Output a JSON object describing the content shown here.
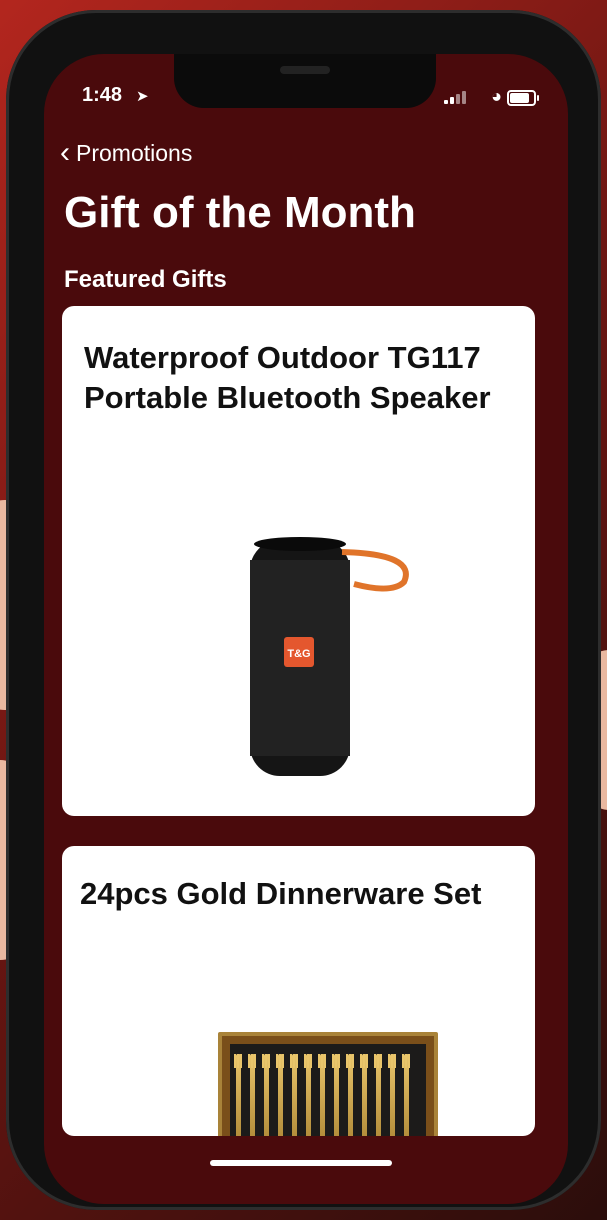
{
  "status_bar": {
    "time": "1:48",
    "location_icon": "location-arrow-icon",
    "signal_icon": "cellular-signal-icon",
    "wifi_icon": "wifi-icon",
    "battery_icon": "battery-icon"
  },
  "nav": {
    "back_label": "Promotions",
    "back_icon": "chevron-left-icon"
  },
  "page": {
    "title": "Gift of the Month",
    "section_title": "Featured Gifts"
  },
  "gifts": [
    {
      "title": "Waterproof Outdoor TG117 Portable Bluetooth Speaker",
      "brand_label": "T&G"
    },
    {
      "title": "24pcs Gold Dinnerware Set"
    }
  ],
  "colors": {
    "screen_background": "#4a0a0c",
    "card_background": "#ffffff",
    "speaker_strap": "#e0742a",
    "brand_badge": "#e4572e"
  }
}
